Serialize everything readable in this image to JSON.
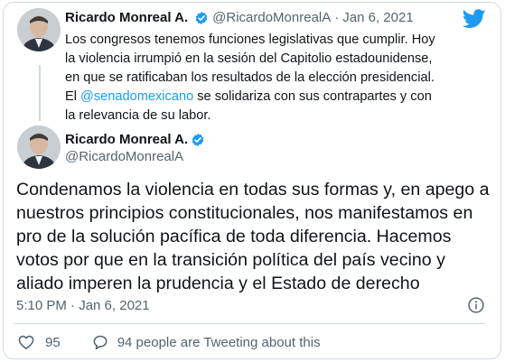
{
  "reply_tweet": {
    "author_name": "Ricardo Monreal A.",
    "author_handle": "@RicardoMonrealA",
    "separator": "·",
    "date": "Jan 6, 2021",
    "text_part1": "Los congresos tenemos funciones legislativas que cumplir. Hoy la violencia irrumpió en la sesión del Capitolio estadounidense, en que se ratificaban los resultados de la elección presidencial. El ",
    "mention": "@senadomexicano",
    "text_part2": " se solidariza con sus contrapartes y con la relevancia de su labor."
  },
  "main_tweet": {
    "author_name": "Ricardo Monreal A.",
    "author_handle": "@RicardoMonrealA",
    "text": "Condenamos la violencia en todas sus formas y, en apego a nuestros principios constitucionales, nos manifestamos en pro de la solución pacífica de toda diferencia. Hacemos votos por que en la transición política del país vecino y aliado imperen la prudencia y el Estado de derecho",
    "timestamp": "5:10 PM · Jan 6, 2021"
  },
  "footer": {
    "likes": "95",
    "tweeting_text": "94 people are Tweeting about this"
  },
  "icons": {
    "brand": "twitter-bird-icon",
    "verified": "verified-badge-icon",
    "info": "info-icon",
    "like": "heart-icon",
    "reply": "speech-bubble-icon"
  },
  "colors": {
    "accent": "#1d9bf0",
    "text": "#0f1419",
    "secondary": "#536471",
    "border": "#cfd9de"
  }
}
